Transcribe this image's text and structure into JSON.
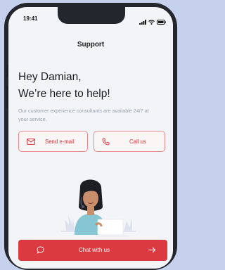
{
  "status_bar": {
    "time": "19:41"
  },
  "header": {
    "title": "Support"
  },
  "greeting": {
    "line1": "Hey Damian,",
    "line2": "We’re here to help!",
    "description": "Our customer experience consultants are available 24/7 at your service."
  },
  "actions": {
    "email_label": "Send e-mail",
    "call_label": "Call us"
  },
  "chat": {
    "label": "Chat with us"
  },
  "colors": {
    "accent": "#dc3a41",
    "background": "#c6d1ee"
  }
}
